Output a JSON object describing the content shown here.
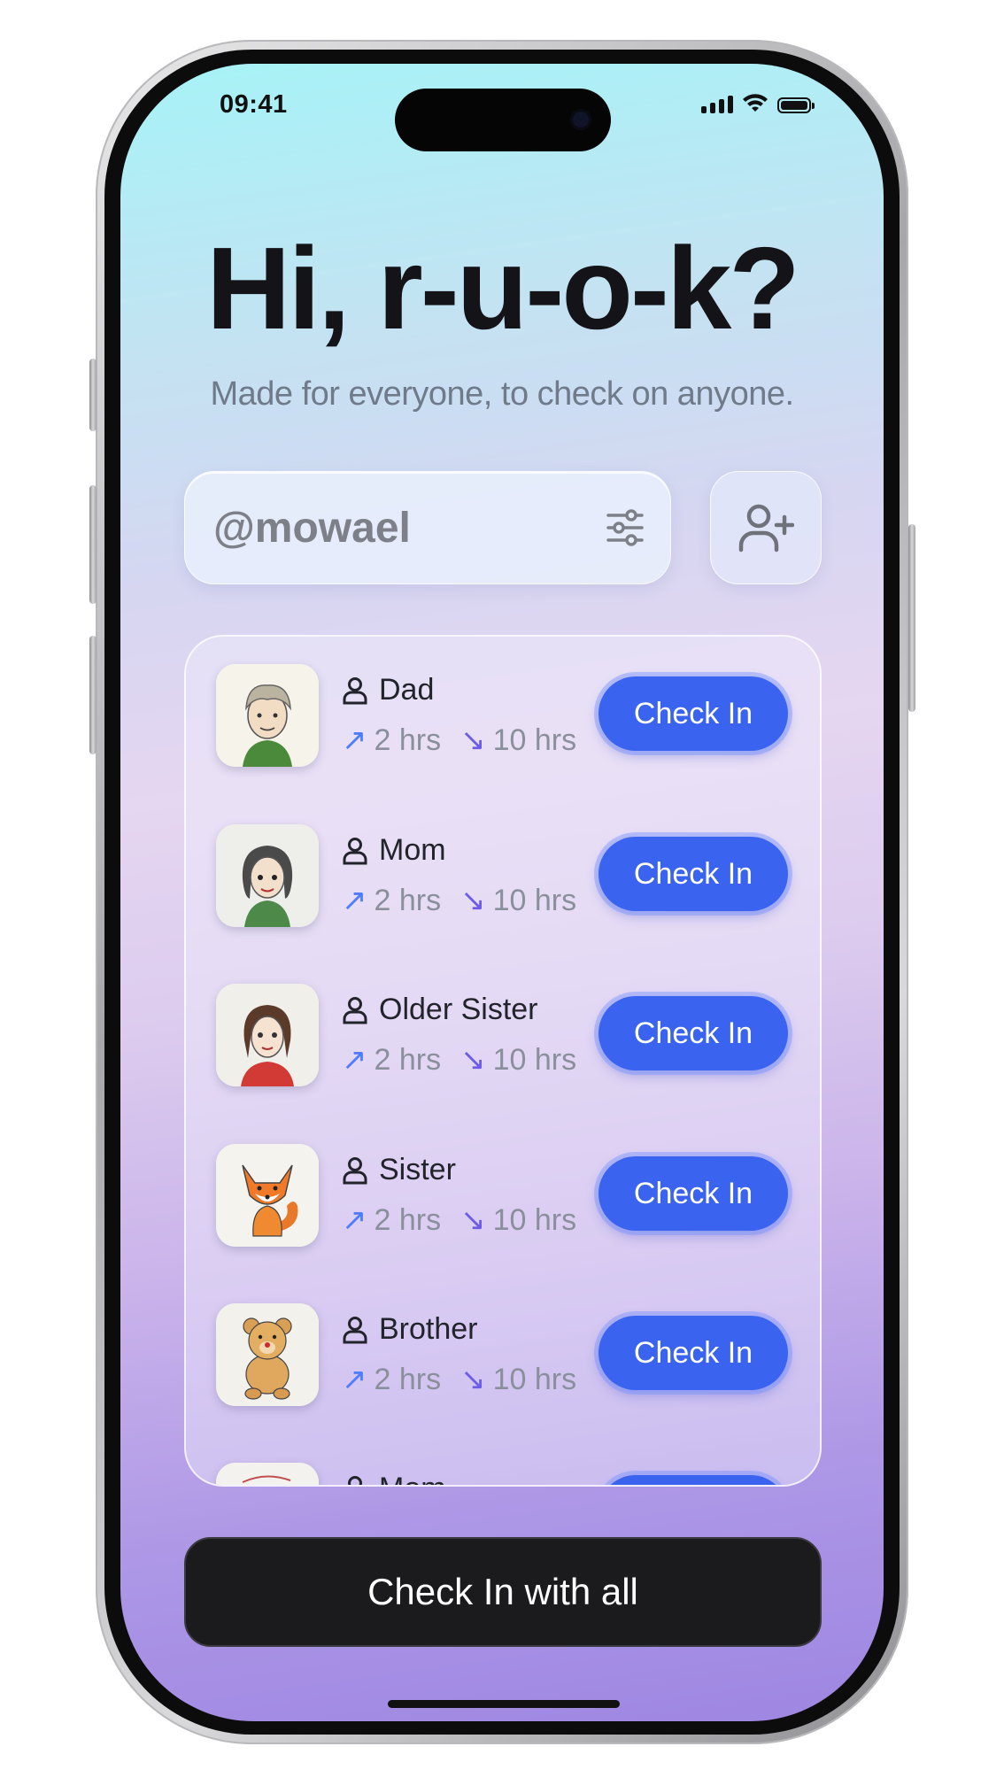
{
  "status_bar": {
    "time": "09:41"
  },
  "header": {
    "title": "Hi, r-u-o-k?",
    "subtitle": "Made for everyone, to check on anyone."
  },
  "search": {
    "value": "@mowael",
    "filter_icon": "sliders-icon",
    "add_icon": "add-user-icon"
  },
  "contacts": [
    {
      "name": "Dad",
      "out": "2 hrs",
      "in": "10 hrs",
      "button": "Check In",
      "avatar": "boy-sketch"
    },
    {
      "name": "Mom",
      "out": "2 hrs",
      "in": "10 hrs",
      "button": "Check In",
      "avatar": "girl-sketch"
    },
    {
      "name": "Older Sister",
      "out": "2 hrs",
      "in": "10 hrs",
      "button": "Check In",
      "avatar": "girl-red-sketch"
    },
    {
      "name": "Sister",
      "out": "2 hrs",
      "in": "10 hrs",
      "button": "Check In",
      "avatar": "fox-sketch"
    },
    {
      "name": "Brother",
      "out": "2 hrs",
      "in": "10 hrs",
      "button": "Check In",
      "avatar": "bear-sketch"
    },
    {
      "name": "Mom",
      "out": "",
      "in": "",
      "button": "",
      "avatar": "partial-sketch"
    }
  ],
  "footer": {
    "check_all_label": "Check In with all"
  },
  "colors": {
    "accent": "#3a63f0",
    "dark_button": "#1b1a1d",
    "arrow_up": "#4f7dff",
    "arrow_down": "#6c5ce7"
  }
}
